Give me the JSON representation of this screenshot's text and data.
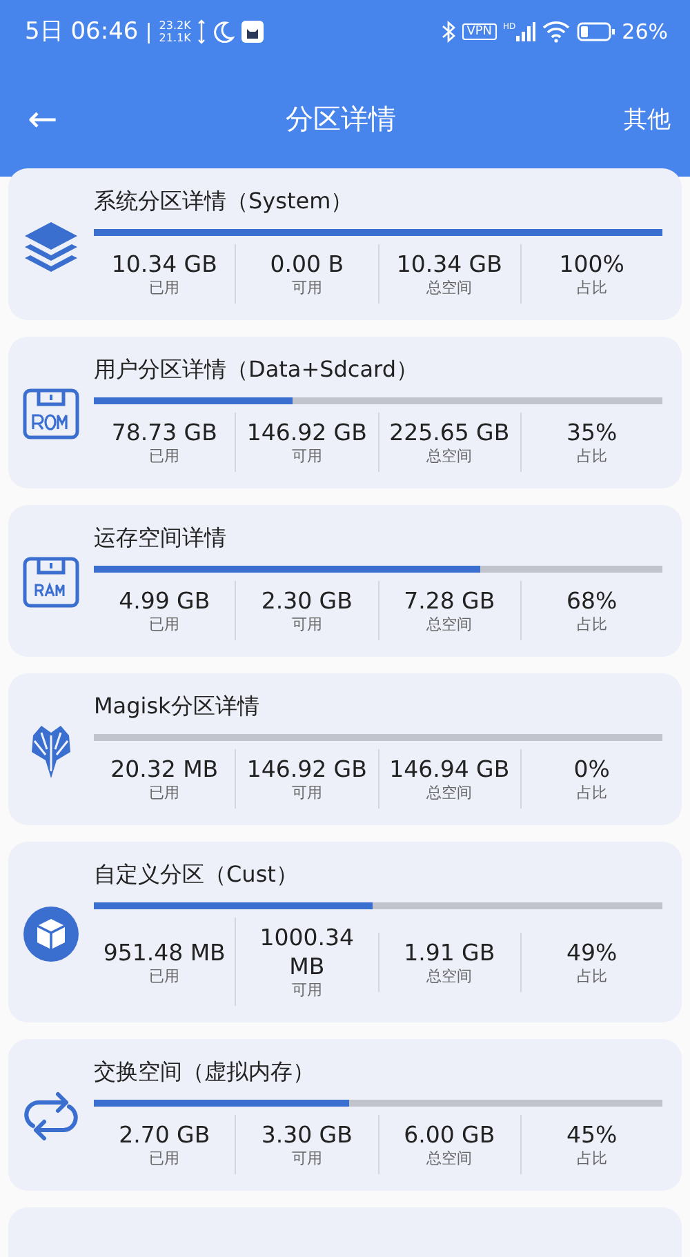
{
  "status_bar": {
    "time": "5日 06:46",
    "separator": "|",
    "upload_speed": "23.2K",
    "download_speed": "21.1K",
    "vpn": "VPN",
    "network": "HD",
    "battery": "26%"
  },
  "toolbar": {
    "back": "←",
    "title": "分区详情",
    "action": "其他"
  },
  "partitions": [
    {
      "kind": "layers",
      "title": "系统分区详情（System）",
      "level": 1.0,
      "stats": [
        {
          "value": "10.34 GB",
          "label": "已用"
        },
        {
          "value": "0.00 B",
          "label": "可用"
        },
        {
          "value": "10.34 GB",
          "label": "总空间"
        },
        {
          "value": "100%",
          "label": "占比"
        }
      ]
    },
    {
      "kind": "rom",
      "title": "用户分区详情（Data+Sdcard）",
      "level": 0.35,
      "stats": [
        {
          "value": "78.73 GB",
          "label": "已用"
        },
        {
          "value": "146.92 GB",
          "label": "可用"
        },
        {
          "value": "225.65 GB",
          "label": "总空间"
        },
        {
          "value": "35%",
          "label": "占比"
        }
      ]
    },
    {
      "kind": "ram",
      "title": "运存空间详情",
      "level": 0.68,
      "stats": [
        {
          "value": "4.99 GB",
          "label": "已用"
        },
        {
          "value": "2.30 GB",
          "label": "可用"
        },
        {
          "value": "7.28 GB",
          "label": "总空间"
        },
        {
          "value": "68%",
          "label": "占比"
        }
      ]
    },
    {
      "kind": "magisk",
      "title": "Magisk分区详情",
      "level": 0.0,
      "stats": [
        {
          "value": "20.32 MB",
          "label": "已用"
        },
        {
          "value": "146.92 GB",
          "label": "可用"
        },
        {
          "value": "146.94 GB",
          "label": "总空间"
        },
        {
          "value": "0%",
          "label": "占比"
        }
      ]
    },
    {
      "kind": "cube",
      "title": "自定义分区（Cust）",
      "level": 0.49,
      "stats": [
        {
          "value": "951.48 MB",
          "label": "已用"
        },
        {
          "value": "1000.34 MB",
          "label": "可用"
        },
        {
          "value": "1.91 GB",
          "label": "总空间"
        },
        {
          "value": "49%",
          "label": "占比"
        }
      ]
    },
    {
      "kind": "swap",
      "title": "交换空间（虚拟内存）",
      "level": 0.45,
      "stats": [
        {
          "value": "2.70 GB",
          "label": "已用"
        },
        {
          "value": "3.30 GB",
          "label": "可用"
        },
        {
          "value": "6.00 GB",
          "label": "总空间"
        },
        {
          "value": "45%",
          "label": "占比"
        }
      ]
    }
  ]
}
